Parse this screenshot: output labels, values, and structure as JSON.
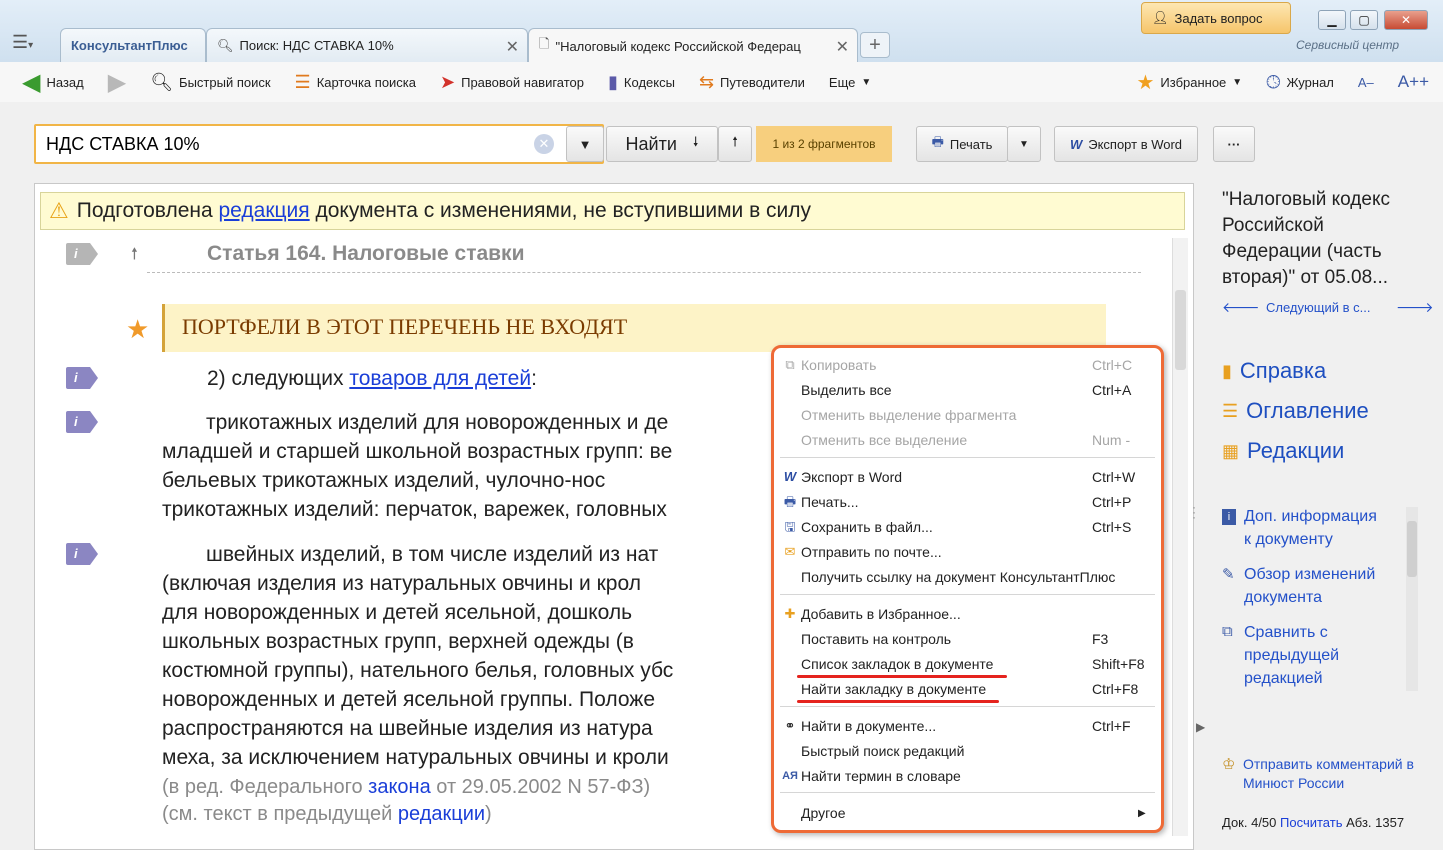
{
  "tabs": [
    {
      "label": "КонсультантПлюс"
    },
    {
      "label": "Поиск: НДС СТАВКА 10%"
    },
    {
      "label": "\"Налоговый кодекс Российской Федерац"
    }
  ],
  "window": {
    "ask_label": "Задать вопрос",
    "brand": "Сервисный центр"
  },
  "toolbar": {
    "back": "Назад",
    "quick_search": "Быстрый поиск",
    "search_card": "Карточка поиска",
    "legal_navigator": "Правовой навигатор",
    "codes": "Кодексы",
    "guides": "Путеводители",
    "more": "Еще",
    "favorites": "Избранное",
    "journal": "Журнал",
    "font_minus": "A–",
    "font_plus": "A++"
  },
  "search": {
    "value": "НДС СТАВКА 10%",
    "find_label": "Найти",
    "fragments": "1 из 2 фрагментов"
  },
  "actions": {
    "print": "Печать",
    "export_word": "Экспорт в Word",
    "more": "···"
  },
  "document": {
    "warning_pre": "Подготовлена ",
    "warning_link": "редакция",
    "warning_post": " документа с изменениями, не вступившими в силу",
    "article_title": "Статья 164. Налоговые ставки",
    "bookmark_title": "ПОРТФЕЛИ В ЭТОТ ПЕРЕЧЕНЬ НЕ ВХОДЯТ",
    "para1_pre": "2) следующих ",
    "para1_link": "товаров для детей",
    "para1_post": ":",
    "para2": [
      "трикотажных изделий для новорожденных и де",
      "младшей и старшей школьной возрастных групп: ве",
      "бельевых     трикотажных     изделий,     чулочно-нос",
      "трикотажных изделий: перчаток, варежек, головных"
    ],
    "para3": [
      "швейных изделий, в том числе изделий из нат",
      "(включая  изделия  из  натуральных  овчины  и  крол",
      "для  новорожденных  и  детей  ясельной,  дошколь",
      "школьных  возрастных  групп,  верхней  одежды  (в",
      "костюмной группы), нательного белья, головных убс",
      "новорожденных  и  детей  ясельной  группы.  Положе",
      "распространяются  на  швейные  изделия  из  натура",
      "меха, за исключением натуральных овчины и кроли"
    ],
    "note1_pre": "(в ред. Федерального ",
    "note1_link": "закона",
    "note1_post": " от 29.05.2002 N 57-ФЗ)",
    "note2_pre": "(см. текст в предыдущей ",
    "note2_link": "редакции",
    "note2_post": ")"
  },
  "context_menu": [
    {
      "label": "Копировать",
      "shortcut": "Ctrl+C",
      "disabled": true,
      "icon": "copy-icon"
    },
    {
      "label": "Выделить все",
      "shortcut": "Ctrl+A",
      "disabled": false
    },
    {
      "label": "Отменить выделение фрагмента",
      "shortcut": "",
      "disabled": true
    },
    {
      "label": "Отменить все выделение",
      "shortcut": "Num -",
      "disabled": true
    },
    {
      "label": "Экспорт в Word",
      "shortcut": "Ctrl+W",
      "disabled": false,
      "icon": "word-icon"
    },
    {
      "label": "Печать...",
      "shortcut": "Ctrl+P",
      "disabled": false,
      "icon": "printer-icon"
    },
    {
      "label": "Сохранить в файл...",
      "shortcut": "Ctrl+S",
      "disabled": false,
      "icon": "save-icon"
    },
    {
      "label": "Отправить по почте...",
      "shortcut": "",
      "disabled": false,
      "icon": "mail-icon"
    },
    {
      "label": "Получить ссылку на документ КонсультантПлюс",
      "shortcut": "",
      "disabled": false
    },
    {
      "label": "Добавить в Избранное...",
      "shortcut": "",
      "disabled": false,
      "icon": "star-plus-icon"
    },
    {
      "label": "Поставить на контроль",
      "shortcut": "F3",
      "disabled": false
    },
    {
      "label": "Список закладок в документе",
      "shortcut": "Shift+F8",
      "disabled": false
    },
    {
      "label": "Найти закладку в документе",
      "shortcut": "Ctrl+F8",
      "disabled": false
    },
    {
      "label": "Найти в документе...",
      "shortcut": "Ctrl+F",
      "disabled": false,
      "icon": "binoculars-icon"
    },
    {
      "label": "Быстрый поиск редакций",
      "shortcut": "",
      "disabled": false
    },
    {
      "label": "Найти термин в словаре",
      "shortcut": "",
      "disabled": false,
      "icon": "dictionary-icon"
    },
    {
      "label": "Другое",
      "shortcut": "",
      "disabled": false
    }
  ],
  "right_pane": {
    "doc_title": [
      "\"Налоговый кодекс",
      "Российской",
      "Федерации (часть",
      "вторая)\" от 05.08..."
    ],
    "next_label": "Следующий в с...",
    "help": "Справка",
    "contents": "Оглавление",
    "editions": "Редакции",
    "extra_info": [
      "Доп. информация",
      "к документу"
    ],
    "changes_review": [
      "Обзор изменений",
      "документа"
    ],
    "compare": [
      "Сравнить с",
      "предыдущей",
      "редакцией"
    ],
    "send_comment": [
      "Отправить комментарий в",
      "Минюст России"
    ],
    "status_pre": "Док. 4/50",
    "status_link": "Посчитать",
    "status_post": "Абз. 1357"
  },
  "colors": {
    "accent": "#ee6a36",
    "link": "#1a3ed8",
    "highlight": "#fdf3c7"
  }
}
